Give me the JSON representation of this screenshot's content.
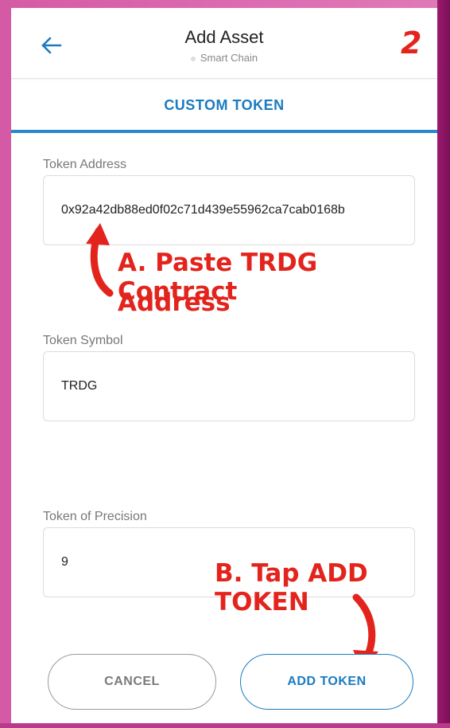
{
  "header": {
    "title": "Add Asset",
    "subtitle": "Smart Chain",
    "step_number": "2"
  },
  "tabs": [
    {
      "label": "CUSTOM TOKEN",
      "active": true
    }
  ],
  "form": {
    "token_address": {
      "label": "Token Address",
      "value": "0x92a42db88ed0f02c71d439e55962ca7cab0168b"
    },
    "token_symbol": {
      "label": "Token Symbol",
      "value": "TRDG"
    },
    "token_precision": {
      "label": "Token of Precision",
      "value": "9"
    }
  },
  "annotations": {
    "step_a_line1": "A. Paste TRDG Contract",
    "step_a_line2": "Address",
    "step_b": "B. Tap ADD TOKEN"
  },
  "buttons": {
    "cancel": "CANCEL",
    "add_token": "ADD TOKEN"
  },
  "colors": {
    "accent": "#1a7bc1",
    "annotation": "#e3241d",
    "border_pink": "#d45aa6",
    "border_purple": "#7b0f58"
  }
}
